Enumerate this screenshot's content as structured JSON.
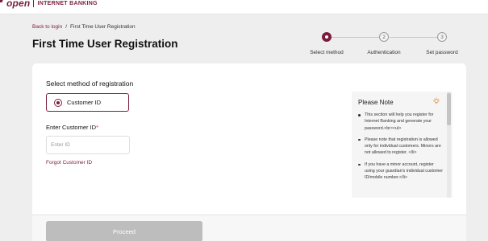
{
  "brand": {
    "logo_main": "open",
    "logo_sub": "INTERNET BANKING",
    "accent_color": "#7b1c3b"
  },
  "breadcrumb": {
    "link": "Back to login",
    "separator": "/",
    "current": "First Time User Registration"
  },
  "page_title": "First Time User Registration",
  "stepper": {
    "steps": [
      {
        "number": "",
        "label": "Select method",
        "state": "active"
      },
      {
        "number": "2",
        "label": "Authentication",
        "state": "pending"
      },
      {
        "number": "3",
        "label": "Set password",
        "state": "pending"
      }
    ]
  },
  "form": {
    "method_heading": "Select method of registration",
    "method_option": "Customer ID",
    "method_selected": true,
    "field_label": "Enter Customer ID",
    "field_required_mark": "*",
    "field_placeholder": "Enter ID",
    "field_value": "",
    "forgot_link": "Forgot Customer ID",
    "proceed_label": "Proceed"
  },
  "note": {
    "title": "Please Note",
    "icon": "lightbulb-icon",
    "items": [
      "This section will help you register for Internet Banking and generate your password.<br><ul>",
      "Please note that registration is allowed only for individual customers. Minors are not allowed to register. </li>",
      "If you have a minor account, register using your guardian's individual customer ID/mobile number.</li>"
    ]
  }
}
